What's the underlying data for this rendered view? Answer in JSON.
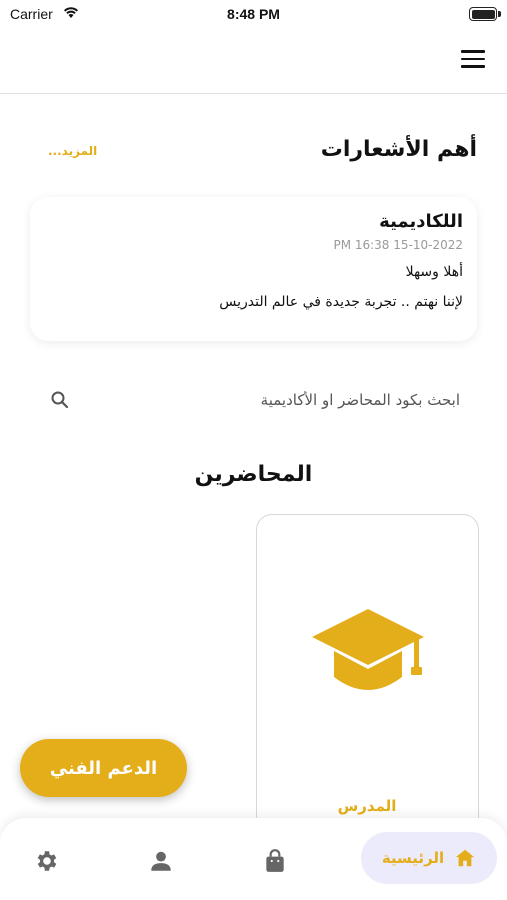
{
  "status_bar": {
    "carrier": "Carrier",
    "time": "8:48 PM"
  },
  "notifications": {
    "title": "أهم الأشعارات",
    "more_label": "المزيد...",
    "items": [
      {
        "sender": "اللكاديمية",
        "date": "PM 16:38 15-10-2022",
        "line1": "أهلا وسهلا",
        "line2": "لإننا نهتم .. تجربة جديدة في عالم التدريس"
      }
    ]
  },
  "search": {
    "placeholder": "ابحث بكود المحاضر او الأكاديمية"
  },
  "lecturers": {
    "title": "المحاضرين",
    "cards": [
      {
        "name": "المدرس",
        "icon": "graduation-cap-icon"
      }
    ]
  },
  "support_button": {
    "label": "الدعم الفني"
  },
  "bottom_nav": {
    "items": [
      {
        "label": "الرئيسية",
        "icon": "home-icon",
        "active": true
      },
      {
        "icon": "shopping-bag-icon"
      },
      {
        "icon": "person-icon"
      },
      {
        "icon": "gear-icon"
      }
    ]
  },
  "colors": {
    "accent": "#e4ae1a",
    "nav_active_bg": "#ecebfb",
    "icon_gray": "#666666"
  }
}
